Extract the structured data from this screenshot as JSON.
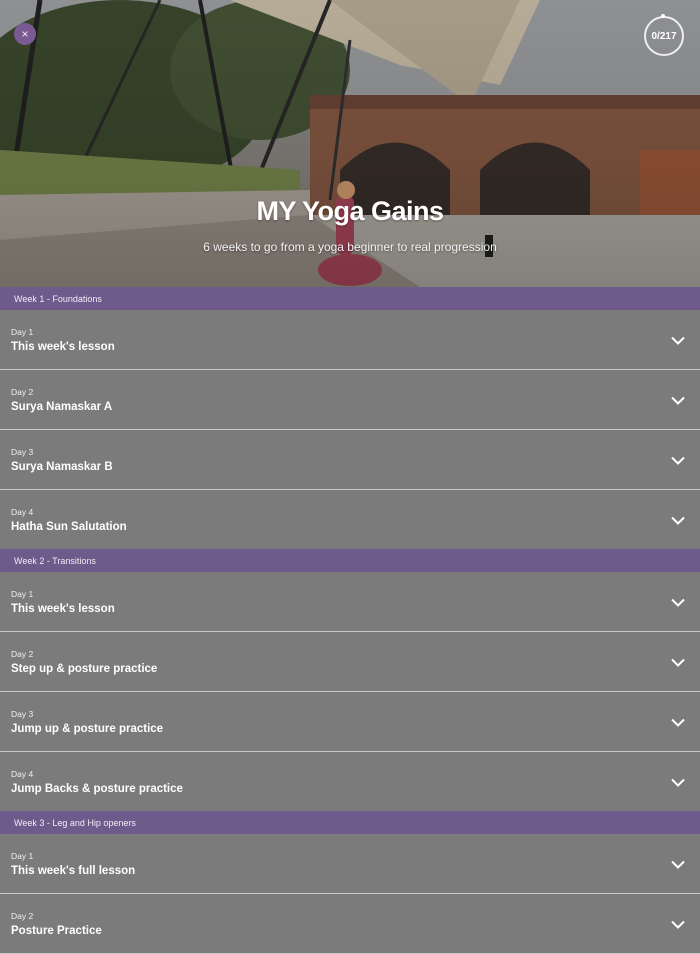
{
  "header": {
    "close_glyph": "×",
    "progress": {
      "text": "0/217",
      "completed": 0,
      "total": 217
    },
    "title": "MY Yoga Gains",
    "subtitle": "6 weeks to go from a yoga beginner to real progression"
  },
  "colors": {
    "accent_purple": "#6f5a8c",
    "close_button": "#7a5a92",
    "row_background": "#7b7b7b",
    "divider": "#c8c8c8"
  },
  "weeks": [
    {
      "title": "Week 1 - Foundations",
      "days": [
        {
          "day": "Day 1",
          "title": "This week's lesson"
        },
        {
          "day": "Day 2",
          "title": "Surya Namaskar A"
        },
        {
          "day": "Day 3",
          "title": "Surya Namaskar B"
        },
        {
          "day": "Day 4",
          "title": "Hatha Sun Salutation"
        }
      ]
    },
    {
      "title": "Week 2 - Transitions",
      "days": [
        {
          "day": "Day 1",
          "title": "This week's lesson"
        },
        {
          "day": "Day 2",
          "title": "Step up & posture practice"
        },
        {
          "day": "Day 3",
          "title": "Jump up & posture practice"
        },
        {
          "day": "Day 4",
          "title": "Jump Backs & posture practice"
        }
      ]
    },
    {
      "title": "Week 3 - Leg and Hip openers",
      "days": [
        {
          "day": "Day 1",
          "title": "This week's full lesson"
        },
        {
          "day": "Day 2",
          "title": "Posture Practice"
        }
      ]
    }
  ],
  "icons": {
    "expand": "chevron-down-icon",
    "close": "close-icon"
  }
}
